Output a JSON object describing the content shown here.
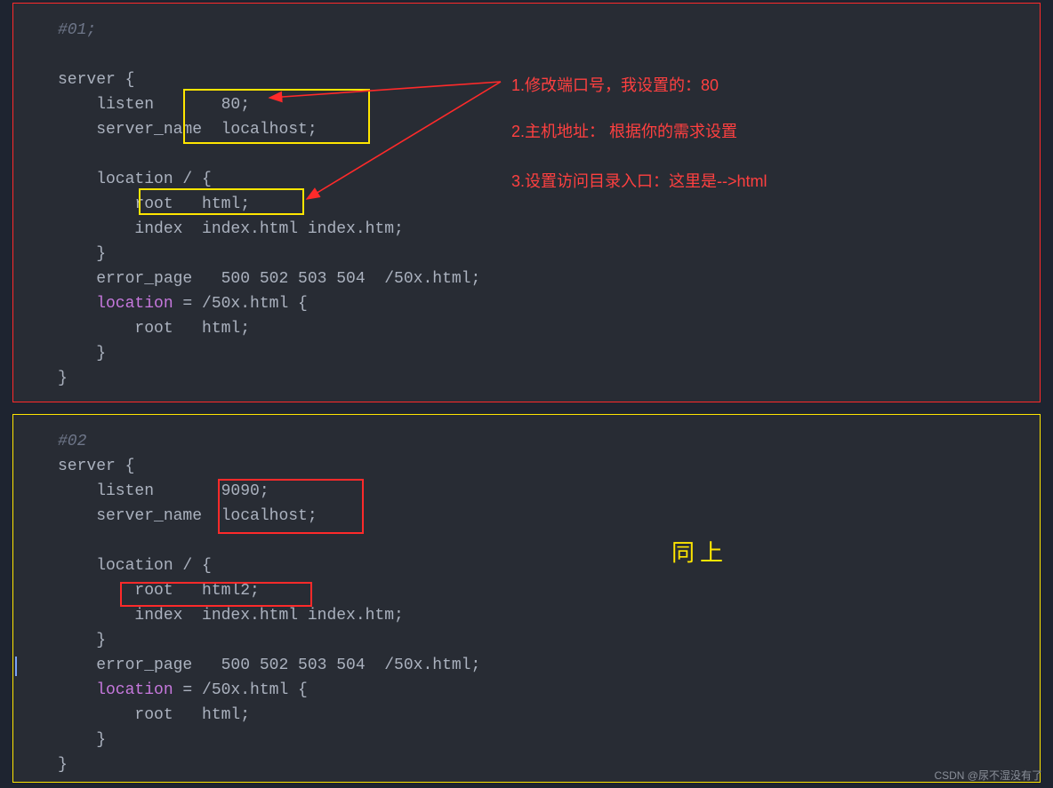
{
  "block1": {
    "comment": "#01;",
    "l1": "server {",
    "l2": "    listen       80;",
    "l3": "    server_name  localhost;",
    "l4": "",
    "l5": "    location / {",
    "l6": "        root   html;",
    "l7": "        index  index.html index.htm;",
    "l8": "    }",
    "l9": "    error_page   500 502 503 504  /50x.html;",
    "l10k": "    location",
    "l10r": " = /50x.html {",
    "l11": "        root   html;",
    "l12": "    }",
    "l13": "}"
  },
  "ann": {
    "a1": "1.修改端口号，我设置的：80",
    "a2": "2.主机地址： 根据你的需求设置",
    "a3": "3.设置访问目录入口：这里是-->html"
  },
  "block2": {
    "comment": "#02",
    "l1": "server {",
    "l2": "    listen       9090;",
    "l3": "    server_name  localhost;",
    "l4": "",
    "l5": "    location / {",
    "l6": "        root   html2;",
    "l7": "        index  index.html index.htm;",
    "l8": "    }",
    "l9": "    error_page   500 502 503 504  /50x.html;",
    "l10k": "    location",
    "l10r": " = /50x.html {",
    "l11": "        root   html;",
    "l12": "    }",
    "l13": "}"
  },
  "ann2": "同上",
  "watermark": "CSDN @尿不湿没有了"
}
